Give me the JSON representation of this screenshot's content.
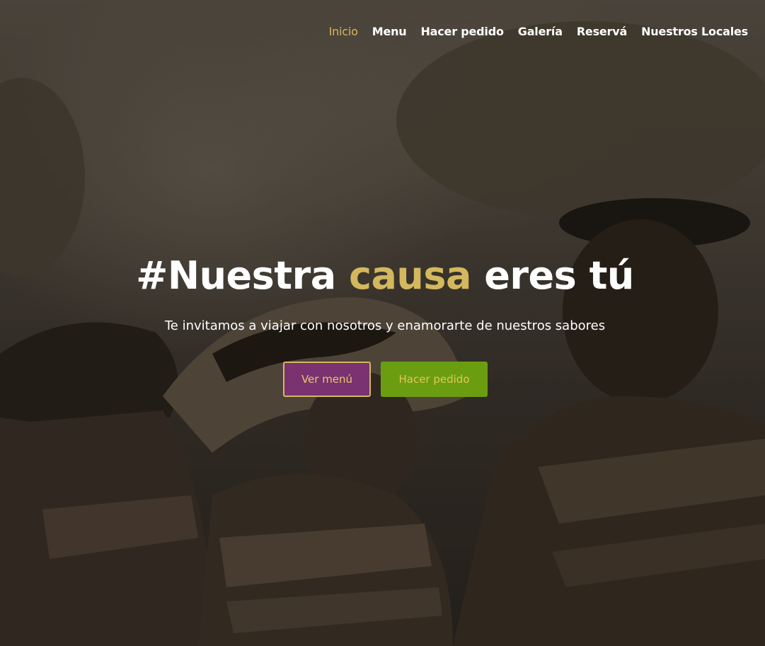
{
  "nav": {
    "items": [
      {
        "label": "Inicio",
        "active": true
      },
      {
        "label": "Menu",
        "active": false
      },
      {
        "label": "Hacer pedido",
        "active": false
      },
      {
        "label": "Galería",
        "active": false
      },
      {
        "label": "Reservá",
        "active": false
      },
      {
        "label": "Nuestros Locales",
        "active": false
      }
    ]
  },
  "hero": {
    "headline_part1": "#Nuestra ",
    "headline_accent": "causa",
    "headline_part2": " eres tú",
    "subtitle": "Te invitamos a viajar con nosotros y enamorarte de nuestros sabores",
    "button_menu_label": "Ver menú",
    "button_order_label": "Hacer pedido"
  },
  "colors": {
    "accent_gold": "#d3b85e",
    "button_purple": "#7a3270",
    "button_green": "#6a9e10"
  }
}
